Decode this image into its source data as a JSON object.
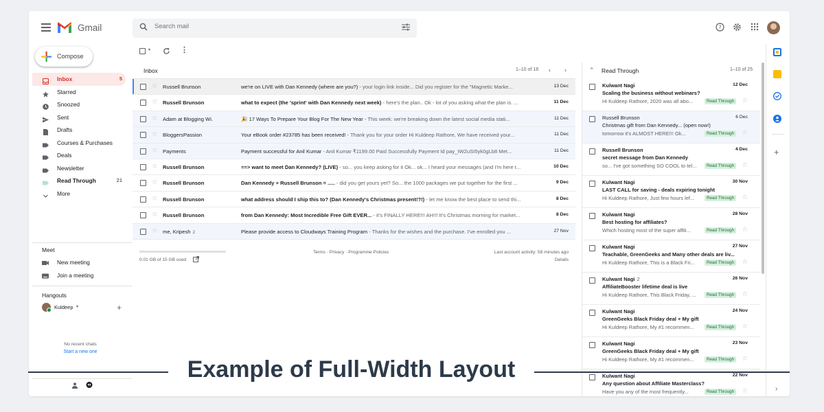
{
  "app": {
    "name": "Gmail"
  },
  "search": {
    "placeholder": "Search mail"
  },
  "compose": {
    "label": "Compose"
  },
  "sidebar": {
    "items": [
      {
        "label": "Inbox",
        "count": "5",
        "icon": "inbox-icon"
      },
      {
        "label": "Starred",
        "count": "",
        "icon": "star-icon"
      },
      {
        "label": "Snoozed",
        "count": "",
        "icon": "clock-icon"
      },
      {
        "label": "Sent",
        "count": "",
        "icon": "send-icon"
      },
      {
        "label": "Drafts",
        "count": "",
        "icon": "draft-icon"
      },
      {
        "label": "Courses & Purchases",
        "count": "",
        "icon": "label-icon"
      },
      {
        "label": "Deals",
        "count": "",
        "icon": "label-icon"
      },
      {
        "label": "Newsletter",
        "count": "",
        "icon": "label-icon"
      },
      {
        "label": "Read Through",
        "count": "21",
        "icon": "label-icon"
      },
      {
        "label": "More",
        "count": "",
        "icon": "chevron-down-icon"
      }
    ],
    "meet": {
      "title": "Meet",
      "new_meeting": "New meeting",
      "join": "Join a meeting"
    },
    "hangouts": {
      "title": "Hangouts",
      "user": "Kuldeep",
      "no_chats": "No recent chats",
      "start_new": "Start a new one"
    }
  },
  "inbox": {
    "title": "Inbox",
    "range": "1–10 of 18",
    "rows": [
      {
        "sender": "Russell Brunson",
        "subject": "we're on LIVE with Dan Kennedy (where are you?)",
        "snippet": " - your login link inside... Did you register for the \"Magnetic Marke...",
        "date": "13 Dec",
        "unread": false
      },
      {
        "sender": "Russell Brunson",
        "subject": "what to expect (the 'sprint' with Dan Kennedy next week)",
        "snippet": " - here's the plan.. Ok - lot of you asking what the plan is. ...",
        "date": "11 Dec",
        "unread": true
      },
      {
        "sender": "Adam at Blogging Wi.",
        "subject": "🎉 17 Ways To Prepare Your Blog For The New Year",
        "snippet": " - This week: we're breaking down the latest social media stati...",
        "date": "11 Dec",
        "unread": false
      },
      {
        "sender": "BloggersPassion",
        "subject": "Your eBook order #23785 has been received!",
        "snippet": " - Thank you for your order Hi Kuldeep Rathore, We have received your...",
        "date": "11 Dec",
        "unread": false
      },
      {
        "sender": "Payments",
        "subject": "Payment successful for Anil Kumar",
        "snippet": " - Anil Kumar ₹1199.00 Paid Successfully Payment Id pay_IW2uSI5yk0gLb8 Met...",
        "date": "11 Dec",
        "unread": false
      },
      {
        "sender": "Russell Brunson",
        "subject": "==> want to meet Dan Kennedy? (LIVE)",
        "snippet": " - so... you keep asking for it Ok... ok... I heard your messages (and I'm here t...",
        "date": "10 Dec",
        "unread": true
      },
      {
        "sender": "Russell Brunson",
        "subject": "Dan Kennedy + Russell Brunson = .....",
        "snippet": " - did you get yours yet? So... the 1000 packages we put together for the first ...",
        "date": "9 Dec",
        "unread": true
      },
      {
        "sender": "Russell Brunson",
        "subject": "what address should I ship this to? (Dan Kennedy's Christmas present!?!)",
        "snippet": " - let me know the best place to send thi...",
        "date": "8 Dec",
        "unread": true
      },
      {
        "sender": "Russell Brunson",
        "subject": "from Dan Kennedy: Most Incredible Free Gift EVER...",
        "snippet": " - it's FINALLY HERE!!! AH!!! It's Christmas morning for market...",
        "date": "8 Dec",
        "unread": true
      },
      {
        "sender": "me, Kripesh",
        "sender_count": "2",
        "subject": "Please provide access to Cloudways Training Program",
        "snippet": " - Thanks for the wishes and the purchase. I've enrolled you ...",
        "date": "27 Nov",
        "unread": false
      }
    ],
    "footer": {
      "storage": "0.01 GB of 15 GB used",
      "links": "Terms · Privacy · Programme Policies",
      "activity": "Last account activity: 58 minutes ago",
      "details": "Details"
    }
  },
  "read_through": {
    "title": "Read Through",
    "range": "1–10 of 25",
    "label": "Read Through",
    "rows": [
      {
        "from": "Kulwant Nagi",
        "count": "",
        "date": "12 Dec",
        "subject": "Scaling the business without webinars?",
        "preview": "Hi Kuldeep Rathore, 2020 was all abo...",
        "read": false
      },
      {
        "from": "Russell Brunson",
        "count": "",
        "date": "6 Dec",
        "subject": "Christmas gift from Dan Kennedy... (open now!)",
        "preview": "tomorrow it's ALMOST HERE!!! Ok...",
        "read": true
      },
      {
        "from": "Russell Brunson",
        "count": "",
        "date": "4 Dec",
        "subject": "secret message from Dan Kennedy",
        "preview": "so... I've got something SO COOL to tel...",
        "read": false
      },
      {
        "from": "Kulwant Nagi",
        "count": "",
        "date": "30 Nov",
        "subject": "LAST CALL for saving - deals expiring tonight",
        "preview": "Hi Kuldeep Rathore, Just few hours lef...",
        "read": false
      },
      {
        "from": "Kulwant Nagi",
        "count": "",
        "date": "28 Nov",
        "subject": "Best hosting for affiliates?",
        "preview": "Which hosting most of the super affili...",
        "read": false
      },
      {
        "from": "Kulwant Nagi",
        "count": "",
        "date": "27 Nov",
        "subject": "Teachable, GreenGeeks and Many other deals are liv...",
        "preview": "Hi Kuldeep Rathore, This is a Black Fri...",
        "read": false
      },
      {
        "from": "Kulwant Nagi",
        "count": "2",
        "date": "26 Nov",
        "subject": "AffiliateBooster lifetime deal is live",
        "preview": "Hi Kuldeep Rathore, This Black Friday, ...",
        "read": false
      },
      {
        "from": "Kulwant Nagi",
        "count": "",
        "date": "24 Nov",
        "subject": "GreenGeeks Black Friday deal + My gift",
        "preview": "Hi Kuldeep Rathore, My #1 recommen...",
        "read": false
      },
      {
        "from": "Kulwant Nagi",
        "count": "",
        "date": "23 Nov",
        "subject": "GreenGeeks Black Friday deal + My gift",
        "preview": "Hi Kuldeep Rathore, My #1 recommen...",
        "read": false
      },
      {
        "from": "Kulwant Nagi",
        "count": "",
        "date": "22 Nov",
        "subject": "Any question about Affiliate Masterclass?",
        "preview": "Have you any of the most frequently...",
        "read": false
      }
    ]
  },
  "overlay": {
    "caption": "Example of Full-Width Layout"
  },
  "colors": {
    "accent": "#d93025",
    "label_bg": "#d7efdf",
    "label_fg": "#137333",
    "caption": "#2d3a4a"
  }
}
